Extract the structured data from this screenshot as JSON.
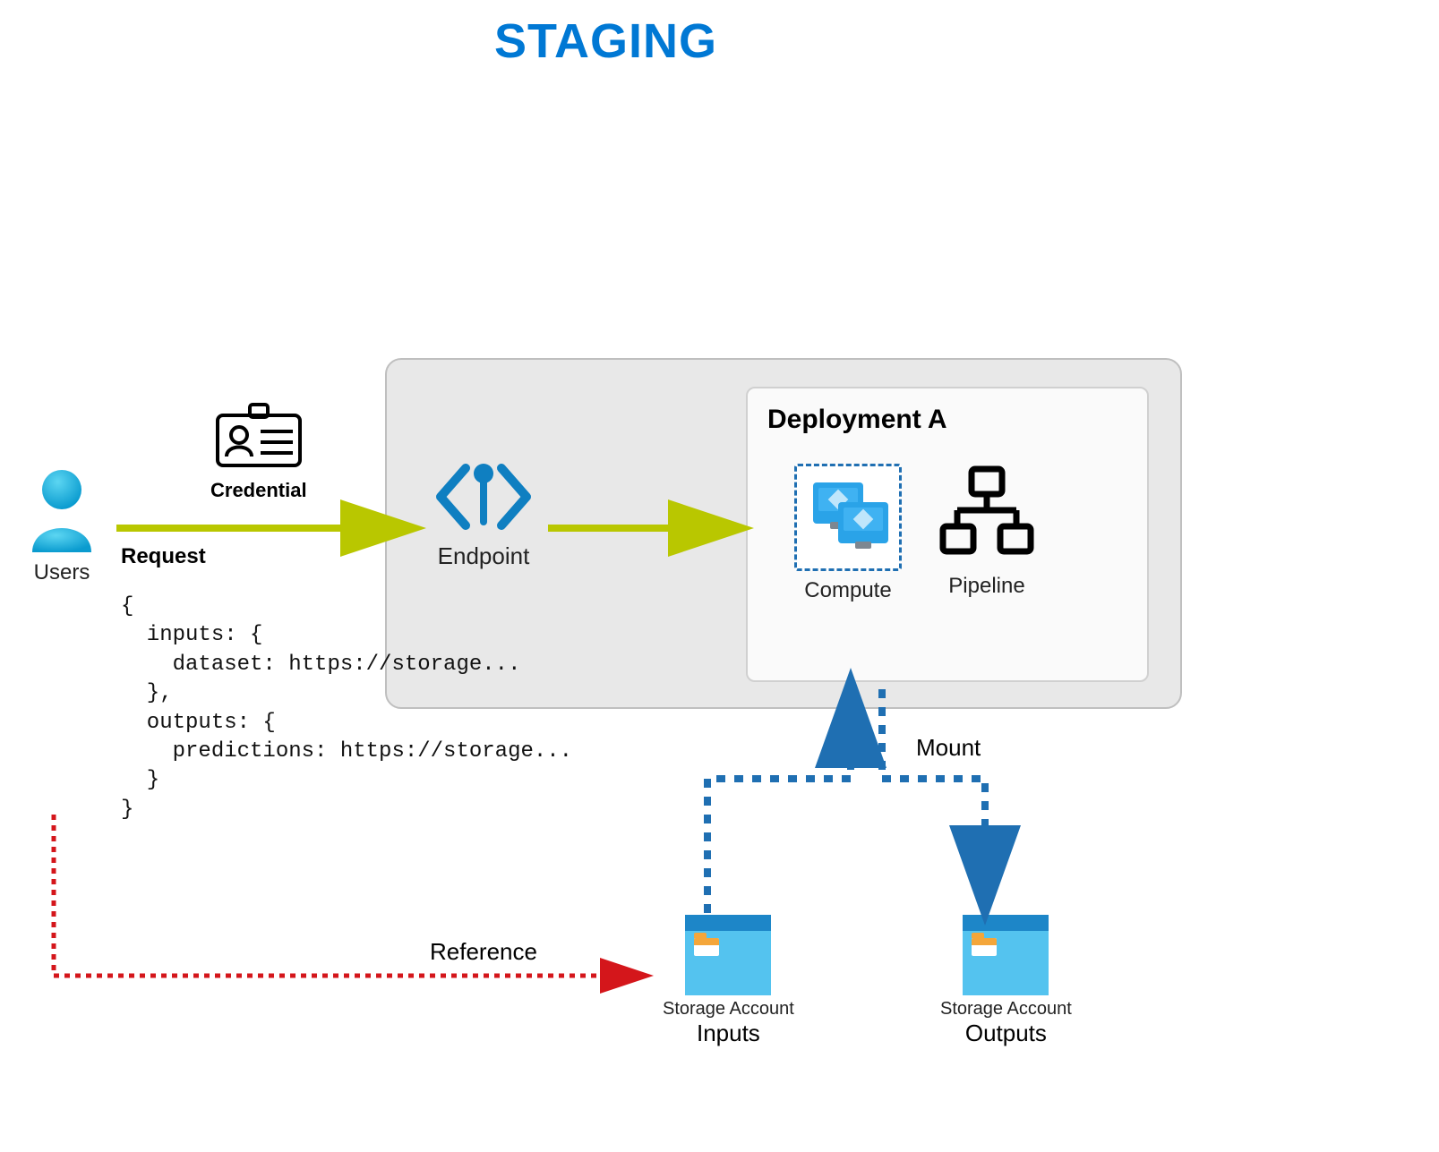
{
  "title": "STAGING",
  "users_label": "Users",
  "credential_label": "Credential",
  "endpoint_label": "Endpoint",
  "deployment": {
    "title": "Deployment A",
    "compute_label": "Compute",
    "pipeline_label": "Pipeline"
  },
  "request": {
    "heading": "Request",
    "code_lines": [
      "{",
      "  inputs: {",
      "    dataset: https://storage...",
      "  },",
      "  outputs: {",
      "    predictions: https://storage...",
      "  }",
      "}"
    ]
  },
  "storage_inputs": {
    "small": "Storage Account",
    "big": "Inputs"
  },
  "storage_outputs": {
    "small": "Storage Account",
    "big": "Outputs"
  },
  "labels": {
    "mount": "Mount",
    "reference": "Reference"
  },
  "colors": {
    "title": "#0078d4",
    "flow_arrow": "#b9c700",
    "mount_arrow": "#1f6fb2",
    "reference_arrow": "#d4161b"
  }
}
